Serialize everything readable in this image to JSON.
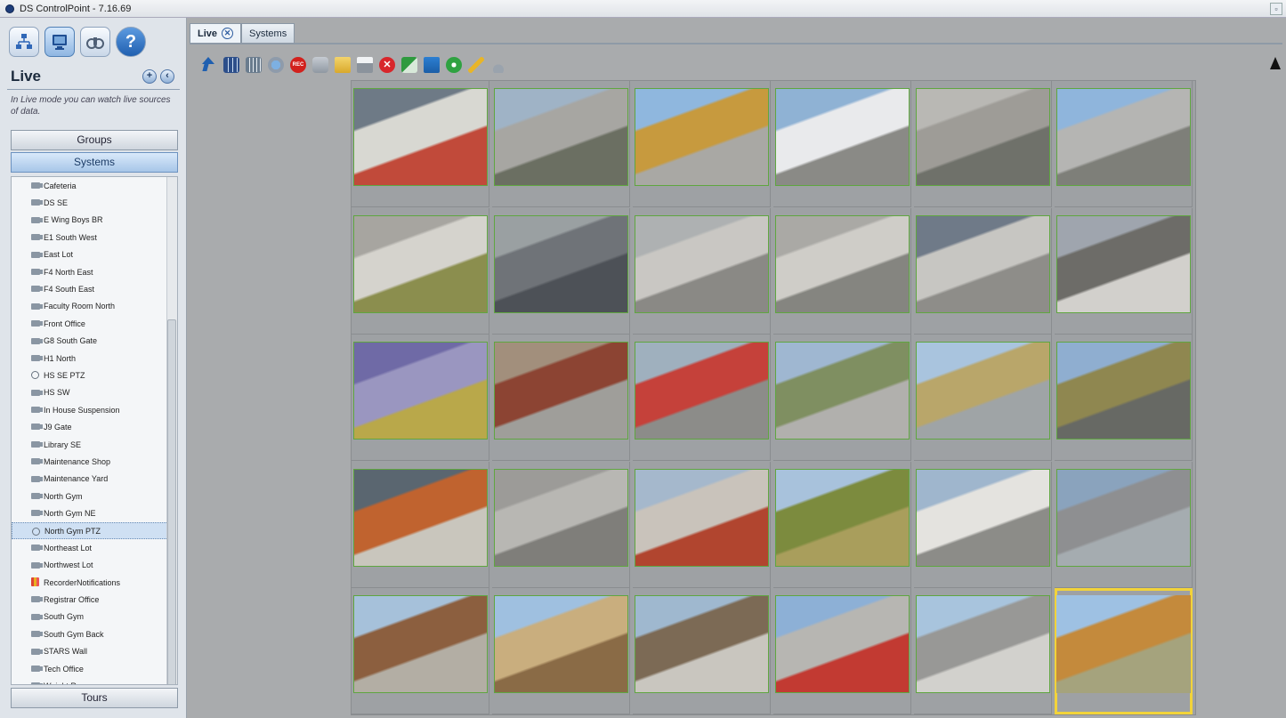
{
  "window": {
    "title": "DS ControlPoint - 7.16.69"
  },
  "sidebar": {
    "mode_title": "Live",
    "hint": "In Live mode you can watch live sources of data.",
    "groups_label": "Groups",
    "systems_label": "Systems",
    "tours_label": "Tours",
    "items": [
      {
        "label": "Cafeteria",
        "type": "camera"
      },
      {
        "label": "DS SE",
        "type": "camera"
      },
      {
        "label": "E Wing Boys BR",
        "type": "camera"
      },
      {
        "label": "E1 South West",
        "type": "camera"
      },
      {
        "label": "East Lot",
        "type": "camera"
      },
      {
        "label": "F4 North East",
        "type": "camera"
      },
      {
        "label": "F4 South East",
        "type": "camera"
      },
      {
        "label": "Faculty Room North",
        "type": "camera"
      },
      {
        "label": "Front Office",
        "type": "camera"
      },
      {
        "label": "G8 South Gate",
        "type": "camera"
      },
      {
        "label": "H1 North",
        "type": "camera"
      },
      {
        "label": "HS SE PTZ",
        "type": "ptz"
      },
      {
        "label": "HS SW",
        "type": "camera"
      },
      {
        "label": "In House Suspension",
        "type": "camera"
      },
      {
        "label": "J9 Gate",
        "type": "camera"
      },
      {
        "label": "Library SE",
        "type": "camera"
      },
      {
        "label": "Maintenance Shop",
        "type": "camera"
      },
      {
        "label": "Maintenance Yard",
        "type": "camera"
      },
      {
        "label": "North Gym",
        "type": "camera"
      },
      {
        "label": "North Gym NE",
        "type": "camera"
      },
      {
        "label": "North Gym PTZ",
        "type": "ptz",
        "selected": true
      },
      {
        "label": "Northeast Lot",
        "type": "camera"
      },
      {
        "label": "Northwest Lot",
        "type": "camera"
      },
      {
        "label": "RecorderNotifications",
        "type": "recorder"
      },
      {
        "label": "Registrar Office",
        "type": "camera"
      },
      {
        "label": "South Gym",
        "type": "camera"
      },
      {
        "label": "South Gym Back",
        "type": "camera"
      },
      {
        "label": "STARS Wall",
        "type": "camera"
      },
      {
        "label": "Tech Office",
        "type": "camera"
      },
      {
        "label": "Weight Room",
        "type": "camera"
      }
    ]
  },
  "tabs": [
    {
      "label": "Live",
      "active": true
    },
    {
      "label": "Systems",
      "active": false
    }
  ],
  "toolbar_icons": [
    "back-arrow-icon",
    "layout-2x2-icon",
    "layout-grid-icon",
    "network-icon",
    "record-icon",
    "camera-icon",
    "folder-icon",
    "print-icon",
    "stop-icon",
    "flag-icon",
    "edit-icon",
    "ptz-control-icon",
    "tool-icon",
    "joystick-icon"
  ],
  "video_grid": {
    "cells": [
      {
        "colors": [
          "#6e7a86",
          "#d8d8d2",
          "#c14a3a"
        ]
      },
      {
        "colors": [
          "#9fb3c6",
          "#a7a6a2",
          "#6b6f62"
        ]
      },
      {
        "colors": [
          "#8fb7de",
          "#c79a3e",
          "#a9a8a4"
        ]
      },
      {
        "colors": [
          "#8fb2d4",
          "#e9eaec",
          "#8a8a86"
        ]
      },
      {
        "colors": [
          "#b9b8b4",
          "#9e9c97",
          "#6f716a"
        ]
      },
      {
        "colors": [
          "#8fb5dc",
          "#b5b5b3",
          "#7e7f79"
        ]
      },
      {
        "colors": [
          "#a7a5a0",
          "#d5d3cd",
          "#8b8e4e"
        ]
      },
      {
        "colors": [
          "#9aa0a2",
          "#6f7378",
          "#4d5157"
        ]
      },
      {
        "colors": [
          "#aeb1b2",
          "#c9c7c3",
          "#8a8985"
        ]
      },
      {
        "colors": [
          "#aaa9a5",
          "#cfcdc8",
          "#858580"
        ]
      },
      {
        "colors": [
          "#6f7a88",
          "#c7c6c2",
          "#8e8d89"
        ]
      },
      {
        "colors": [
          "#9fa5ae",
          "#6d6c68",
          "#d2d0cc"
        ]
      },
      {
        "colors": [
          "#6f6aa6",
          "#9a96c0",
          "#b9a84a"
        ]
      },
      {
        "colors": [
          "#a28f7c",
          "#8c4433",
          "#9f9e9a"
        ]
      },
      {
        "colors": [
          "#9fb0be",
          "#c5413a",
          "#8c8c89"
        ]
      },
      {
        "colors": [
          "#9fb7d1",
          "#7f8f61",
          "#b1b0ad"
        ]
      },
      {
        "colors": [
          "#a9c4de",
          "#b9a66a",
          "#9fa4a6"
        ]
      },
      {
        "colors": [
          "#8faed0",
          "#8f8750",
          "#676964"
        ]
      },
      {
        "colors": [
          "#5a6670",
          "#c0632f",
          "#c9c6bd"
        ]
      },
      {
        "colors": [
          "#9c9b98",
          "#b8b7b3",
          "#7f7e7a"
        ]
      },
      {
        "colors": [
          "#a5b8cc",
          "#c9c3bb",
          "#b1452f"
        ]
      },
      {
        "colors": [
          "#a8c2dc",
          "#7c8b3e",
          "#a99e5c"
        ]
      },
      {
        "colors": [
          "#9fb6cd",
          "#e4e3df",
          "#8c8c88"
        ]
      },
      {
        "colors": [
          "#8aa3bd",
          "#8e8f91",
          "#a5acb0"
        ]
      },
      {
        "colors": [
          "#a6c1da",
          "#8c5f3f",
          "#b3aea4"
        ]
      },
      {
        "colors": [
          "#9fc0e0",
          "#c9ae7e",
          "#8a6b46"
        ]
      },
      {
        "colors": [
          "#9fb8cf",
          "#7c6a55",
          "#c9c6bf"
        ]
      },
      {
        "colors": [
          "#8db0d6",
          "#b7b6b2",
          "#c23a32"
        ]
      },
      {
        "colors": [
          "#a8c4dd",
          "#989896",
          "#d2d1cd"
        ]
      },
      {
        "colors": [
          "#9ec1e3",
          "#c48a3c",
          "#a5a37d"
        ]
      }
    ]
  }
}
